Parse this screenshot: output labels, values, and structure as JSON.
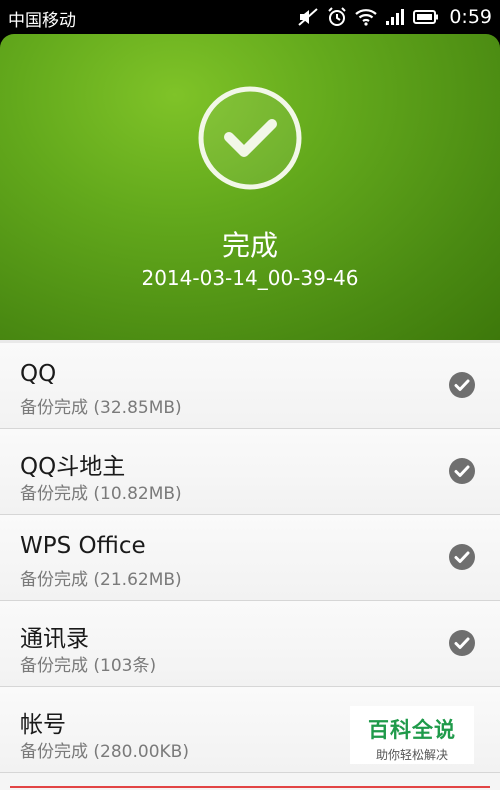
{
  "status_bar": {
    "carrier": "中国移动",
    "time": "0:59",
    "icons": [
      "mute-icon",
      "alarm-icon",
      "wifi-icon",
      "signal-icon",
      "battery-icon"
    ]
  },
  "header": {
    "icon": "check-circle-icon",
    "title": "完成",
    "timestamp": "2014-03-14_00-39-46",
    "color": "#5fa31a"
  },
  "items": [
    {
      "name": "QQ",
      "status": "备份完成 (32.85MB)"
    },
    {
      "name": "QQ斗地主",
      "status": "备份完成 (10.82MB)"
    },
    {
      "name": "WPS Office",
      "status": "备份完成 (21.62MB)"
    },
    {
      "name": "通讯录",
      "status": "备份完成 (103条)"
    },
    {
      "name": "帐号",
      "status": "备份完成 (280.00KB)"
    }
  ],
  "watermark": {
    "title": "百科全说",
    "subtitle": "助你轻松解决"
  }
}
